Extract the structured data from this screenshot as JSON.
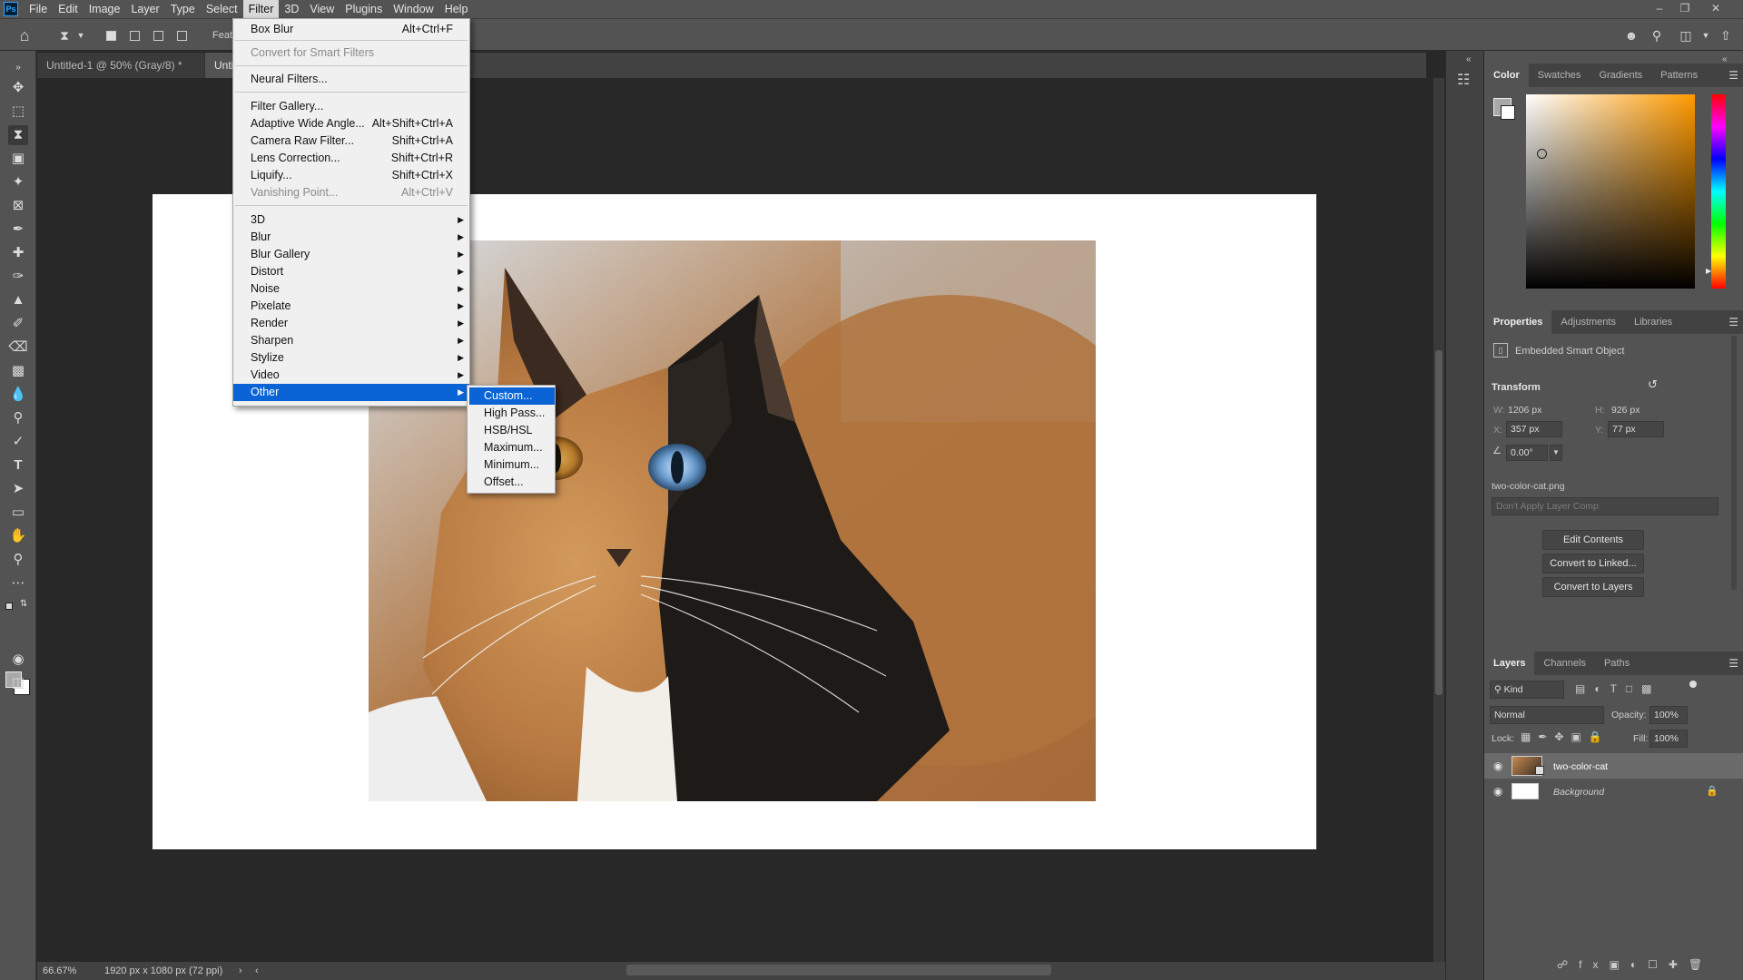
{
  "app": {
    "logo": "Ps"
  },
  "menubar": {
    "items": [
      "File",
      "Edit",
      "Image",
      "Layer",
      "Type",
      "Select",
      "Filter",
      "3D",
      "View",
      "Plugins",
      "Window",
      "Help"
    ],
    "active": "Filter"
  },
  "optionsbar": {
    "feather_label": "Feath"
  },
  "document": {
    "tabs": [
      {
        "label": "Untitled-1 @ 50% (Gray/8) *",
        "close": "×"
      },
      {
        "label": "Unti"
      }
    ]
  },
  "filter_menu": {
    "items": [
      {
        "label": "Box Blur",
        "shortcut": "Alt+Ctrl+F"
      },
      {
        "label": "Convert for Smart Filters",
        "disabled": true
      },
      {
        "label": "Neural Filters..."
      },
      {
        "label": "Filter Gallery..."
      },
      {
        "label": "Adaptive Wide Angle...",
        "shortcut": "Alt+Shift+Ctrl+A"
      },
      {
        "label": "Camera Raw Filter...",
        "shortcut": "Shift+Ctrl+A"
      },
      {
        "label": "Lens Correction...",
        "shortcut": "Shift+Ctrl+R"
      },
      {
        "label": "Liquify...",
        "shortcut": "Shift+Ctrl+X"
      },
      {
        "label": "Vanishing Point...",
        "shortcut": "Alt+Ctrl+V",
        "disabled": true
      },
      {
        "label": "3D",
        "submenu": true
      },
      {
        "label": "Blur",
        "submenu": true
      },
      {
        "label": "Blur Gallery",
        "submenu": true
      },
      {
        "label": "Distort",
        "submenu": true
      },
      {
        "label": "Noise",
        "submenu": true
      },
      {
        "label": "Pixelate",
        "submenu": true
      },
      {
        "label": "Render",
        "submenu": true
      },
      {
        "label": "Sharpen",
        "submenu": true
      },
      {
        "label": "Stylize",
        "submenu": true
      },
      {
        "label": "Video",
        "submenu": true
      },
      {
        "label": "Other",
        "submenu": true,
        "highlighted": true
      }
    ]
  },
  "other_submenu": {
    "items": [
      {
        "label": "Custom...",
        "highlighted": true
      },
      {
        "label": "High Pass..."
      },
      {
        "label": "HSB/HSL"
      },
      {
        "label": "Maximum..."
      },
      {
        "label": "Minimum..."
      },
      {
        "label": "Offset..."
      }
    ]
  },
  "color_panel": {
    "tabs": [
      "Color",
      "Swatches",
      "Gradients",
      "Patterns"
    ],
    "active_tab": "Color",
    "accent_hue": "#ff9a00"
  },
  "properties_panel": {
    "tabs": [
      "Properties",
      "Adjustments",
      "Libraries"
    ],
    "active_tab": "Properties",
    "object_type": "Embedded Smart Object",
    "section": "Transform",
    "w_label": "W:",
    "w_value": "1206 px",
    "h_label": "H:",
    "h_value": "926 px",
    "x_label": "X:",
    "x_value": "357 px",
    "y_label": "Y:",
    "y_value": "77 px",
    "angle_value": "0.00°",
    "filename": "two-color-cat.png",
    "layer_comp_placeholder": "Don't Apply Layer Comp",
    "buttons": [
      "Edit Contents",
      "Convert to Linked...",
      "Convert to Layers"
    ]
  },
  "layers_panel": {
    "tabs": [
      "Layers",
      "Channels",
      "Paths"
    ],
    "active_tab": "Layers",
    "filter_kind": "Kind",
    "blend_mode": "Normal",
    "opacity_label": "Opacity:",
    "opacity_value": "100%",
    "lock_label": "Lock:",
    "fill_label": "Fill:",
    "fill_value": "100%",
    "layers": [
      {
        "name": "two-color-cat",
        "selected": true
      },
      {
        "name": "Background",
        "locked": true
      }
    ]
  },
  "statusbar": {
    "zoom": "66.67%",
    "doc_info": "1920 px x 1080 px (72 ppi)"
  }
}
